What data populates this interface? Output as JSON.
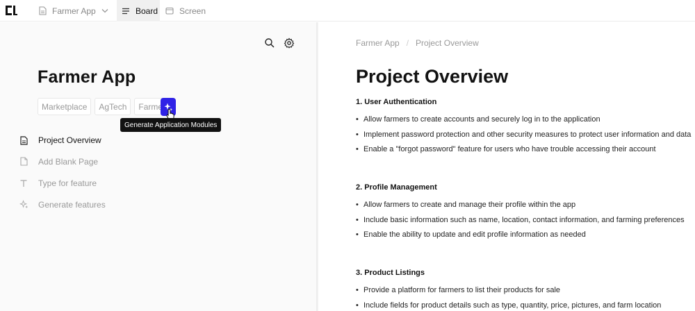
{
  "topbar": {
    "project_name": "Farmer App",
    "tabs": [
      {
        "label": "Board",
        "active": true
      },
      {
        "label": "Screen",
        "active": false
      }
    ]
  },
  "left": {
    "app_title": "Farmer App",
    "tags": [
      "Marketplace",
      "AgTech",
      "Farmer"
    ],
    "generate_button": {
      "icon": "sparkle-icon",
      "tooltip": "Generate Application Modules"
    },
    "nav": [
      {
        "label": "Project Overview",
        "icon": "document-icon",
        "active": true
      },
      {
        "label": "Add Blank Page",
        "icon": "blank-page-icon",
        "active": false
      },
      {
        "label": "Type for feature",
        "icon": "text-icon",
        "active": false
      },
      {
        "label": "Generate features",
        "icon": "sparkle-icon",
        "active": false
      }
    ]
  },
  "right": {
    "breadcrumb": [
      "Farmer App",
      "Project Overview"
    ],
    "title": "Project Overview",
    "sections": [
      {
        "heading": "1. User Authentication",
        "items": [
          "Allow farmers to create accounts and securely log in to the application",
          "Implement password protection and other security measures to protect user information and data",
          "Enable a \"forgot password\" feature for users who have trouble accessing their account"
        ]
      },
      {
        "heading": "2. Profile Management",
        "items": [
          "Allow farmers to create and manage their profile within the app",
          "Include basic information such as name, location, contact information, and farming preferences",
          "Enable the ability to update and edit profile information as needed"
        ]
      },
      {
        "heading": "3. Product Listings",
        "items": [
          "Provide a platform for farmers to list their products for sale",
          "Include fields for product details such as type, quantity, price, pictures, and farm location"
        ]
      }
    ]
  },
  "colors": {
    "accent": "#2f22e6",
    "tooltip_bg": "#111111",
    "left_pane_bg": "#fafafa"
  }
}
